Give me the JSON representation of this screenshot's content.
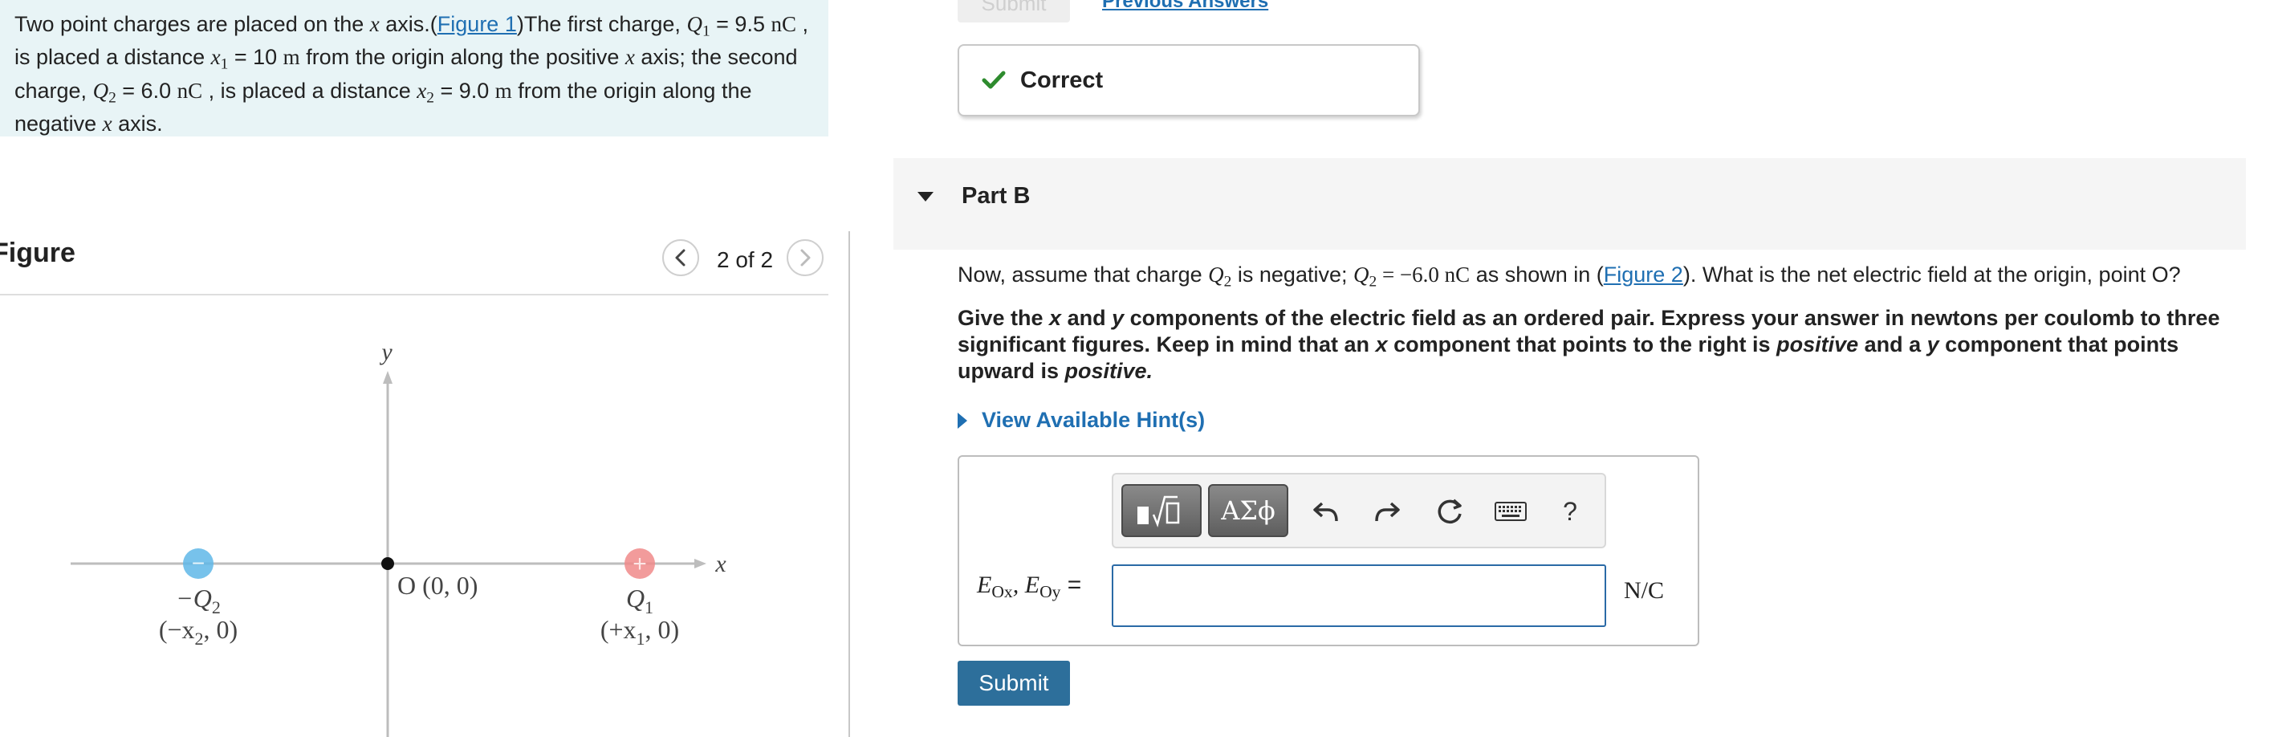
{
  "problem": {
    "t1": "Two point charges are placed on the ",
    "x": "x",
    "t2": " axis.(",
    "figure_link": "Figure 1",
    "t3": ")The first charge, ",
    "q1_sym": "Q",
    "q1_sub": "1",
    "eq1": " = 9.5 ",
    "unit_nC": "nC",
    "t4": " , is placed a distance ",
    "x1_sym": "x",
    "x1_sub": "1",
    "eq2": " = 10 ",
    "unit_m": "m",
    "t5": "  from the origin along the positive ",
    "t6": " axis; the second charge, ",
    "q2_sym": "Q",
    "q2_sub": "2",
    "eq3": " = 6.0 ",
    "t7": " , is placed a distance ",
    "x2_sym": "x",
    "x2_sub": "2",
    "eq4": " = 9.0 ",
    "t8": " from the origin along the negative ",
    "t9": " axis."
  },
  "figure_panel": {
    "title": "Figure",
    "counter": "2 of 2",
    "prev_icon": "chevron-left-icon",
    "next_icon": "chevron-right-icon"
  },
  "diagram": {
    "y_label": "y",
    "x_label": "x",
    "origin_label": "O (0, 0)",
    "left_charge": {
      "label": "−Q",
      "sub": "2",
      "coord_a": "(−x",
      "coord_sub": "2",
      "coord_b": ", 0)",
      "sign": "−",
      "color": "#5fb7e8"
    },
    "right_charge": {
      "label": "Q",
      "sub": "1",
      "coord_a": "(+x",
      "coord_sub": "1",
      "coord_b": ", 0)",
      "sign": "+",
      "color": "#f08a8a"
    }
  },
  "previous": {
    "submit_label": "Submit",
    "answers_link": "Previous Answers"
  },
  "feedback": {
    "icon": "checkmark-icon",
    "label": "Correct",
    "color": "#2e8b2e"
  },
  "part_b": {
    "title": "Part B",
    "q1": "Now, assume that charge ",
    "q2_sym": "Q",
    "q2_sub": "2",
    "q3": " is negative; ",
    "q4": " = −6.0 ",
    "q5": "nC",
    "q6": "  as shown in (",
    "figure_link": "Figure 2",
    "q7": "). What is the net electric field at the origin, point O?",
    "i1": "Give the ",
    "i_x": "x",
    "i2": " and ",
    "i_y": "y",
    "i3": " components of the electric field as an ordered pair. Express your answer in newtons per coulomb to three significant figures. Keep in mind that an ",
    "i4": " component that points to the right is ",
    "i_pos": "positive",
    "i5": " and a ",
    "i6": " component that points upward is ",
    "i_pos2": "positive."
  },
  "hint": {
    "label": "View Available Hint(s)"
  },
  "answer": {
    "toolbar": {
      "templates_icon": "math-templates-icon",
      "symbols_label": "ΑΣϕ",
      "undo_icon": "undo-icon",
      "redo_icon": "redo-icon",
      "reset_icon": "reset-icon",
      "keyboard_icon": "keyboard-icon",
      "help_label": "?"
    },
    "label_a": "E",
    "label_a_sub": "Ox",
    "label_sep": ", ",
    "label_b": "E",
    "label_b_sub": "Oy",
    "label_eq": " =",
    "value": "",
    "unit": "N/C"
  },
  "submit": {
    "label": "Submit"
  },
  "colors": {
    "accent": "#2d6f9b",
    "link": "#1f6fb2",
    "problem_bg": "#e8f4f6"
  }
}
